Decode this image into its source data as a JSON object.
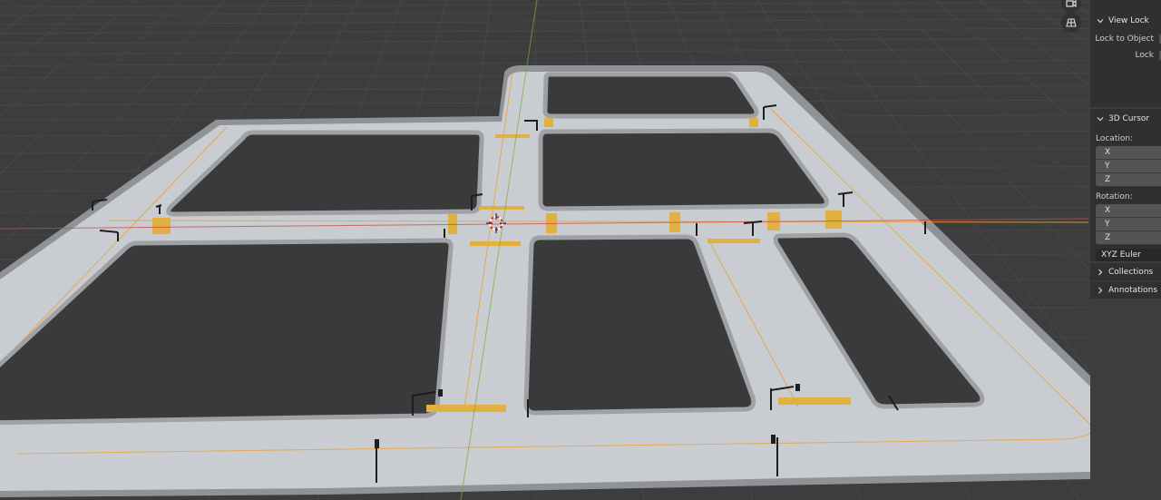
{
  "viewport": {
    "tool_icons": [
      "camera-icon",
      "grid-perspective-icon"
    ]
  },
  "sidebar": {
    "view_lock": {
      "header": "View Lock",
      "lock_to_object_label": "Lock to Object",
      "lock_label": "Lock"
    },
    "cursor_3d": {
      "header": "3D Cursor",
      "location_label": "Location:",
      "location_axes": [
        "X",
        "Y",
        "Z"
      ],
      "rotation_label": "Rotation:",
      "rotation_axes": [
        "X",
        "Y",
        "Z"
      ],
      "rotation_mode": "XYZ Euler"
    },
    "collections_label": "Collections",
    "annotations_label": "Annotations"
  },
  "colors": {
    "background": "#3d3d3d",
    "road": "#c9ccd0",
    "block": "#3a3a3a",
    "lane_marking": "#e8a23a",
    "x_axis": "#c84848",
    "y_axis": "#7fa83c",
    "panel": "#303030",
    "field": "#545454"
  }
}
